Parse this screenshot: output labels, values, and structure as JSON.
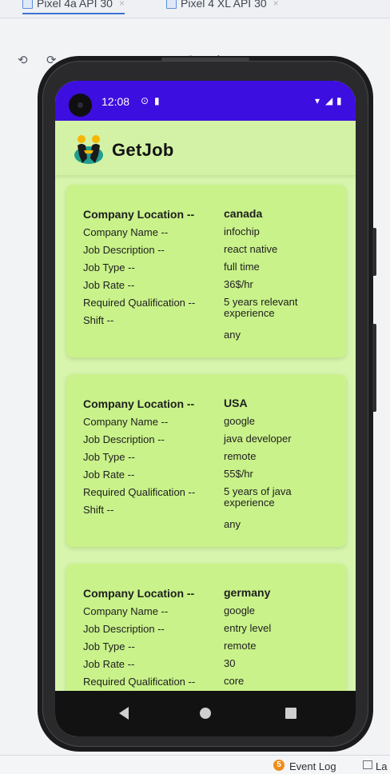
{
  "ide": {
    "tabs": [
      {
        "label": "Pixel 4a API 30",
        "close": "×"
      },
      {
        "label": "Pixel 4 XL API 30",
        "close": "×"
      }
    ],
    "toolbar_icons": [
      "rotate-left-icon",
      "rotate-right-icon",
      "back-icon",
      "home-icon",
      "overview-icon",
      "screenshot-icon",
      "snapshot-icon",
      "more-icon"
    ],
    "toolbar_glyphs": [
      "⟲",
      "⟳",
      "◀",
      "●",
      "■",
      "◘",
      "↺",
      "⋮"
    ],
    "bottom": {
      "event_log_count": "5",
      "event_log_label": "Event Log",
      "layout_label": "La"
    }
  },
  "device": {
    "status_bar": {
      "time": "12:08",
      "color": "#3d0ee0"
    },
    "app": {
      "name": "GetJob",
      "background": "#d8f5ae",
      "card_color": "#c9f28a"
    },
    "labels": {
      "location": "Company Location --",
      "name": "Company Name --",
      "description": "Job Description --",
      "type": "Job Type --",
      "rate": "Job Rate --",
      "qualification": "Required Qualification --",
      "shift": "Shift --"
    },
    "jobs": [
      {
        "location": "canada",
        "name": "infochip",
        "description": "react native",
        "type": "full time",
        "rate": "36$/hr",
        "qualification": "5 years relevant experience",
        "shift": "any"
      },
      {
        "location": "USA",
        "name": "google",
        "description": "java developer",
        "type": "remote",
        "rate": "55$/hr",
        "qualification": "5 years of java experience",
        "shift": "any"
      },
      {
        "location": "germany",
        "name": "google",
        "description": "entry level",
        "type": "remote",
        "rate": "30",
        "qualification": "core",
        "shift": ""
      }
    ]
  }
}
